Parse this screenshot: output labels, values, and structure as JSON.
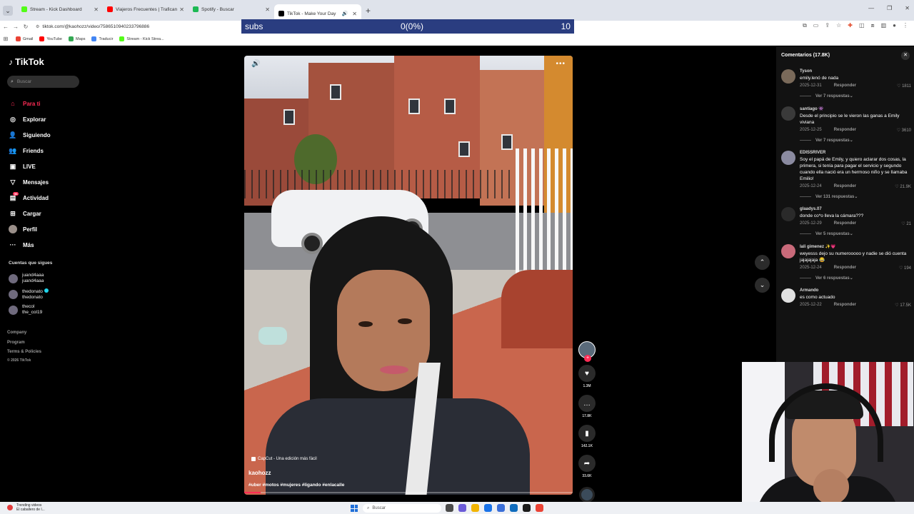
{
  "browser": {
    "tabs": [
      {
        "title": "Stream - Kick Dashboard",
        "favicon_color": "#53fc18"
      },
      {
        "title": "Viajeros Frecuentes | Traficante...",
        "favicon_color": "#ff0000"
      },
      {
        "title": "Spotify - Buscar",
        "favicon_color": "#1db954"
      },
      {
        "title": "TikTok - Make Your Day",
        "favicon_color": "#000000",
        "active": true
      }
    ],
    "url": "tiktok.com/@kaohozz/video/7586510940233796886",
    "bookmarks": [
      {
        "label": "Gmail",
        "color": "#ea4335"
      },
      {
        "label": "YouTube",
        "color": "#ff0000"
      },
      {
        "label": "Maps",
        "color": "#34a853"
      },
      {
        "label": "Traducir",
        "color": "#4285f4"
      },
      {
        "label": "Stream - Kick Strea...",
        "color": "#53fc18"
      }
    ]
  },
  "subs_overlay": {
    "label": "subs",
    "progress": "0(0%)",
    "goal": "10"
  },
  "sidebar": {
    "logo": "TikTok",
    "search_placeholder": "Buscar",
    "nav": [
      {
        "label": "Para ti",
        "icon": "home-icon",
        "glyph": "⌂",
        "active": true
      },
      {
        "label": "Explorar",
        "icon": "compass-icon",
        "glyph": "◎"
      },
      {
        "label": "Siguiendo",
        "icon": "user-follow-icon",
        "glyph": "👤"
      },
      {
        "label": "Friends",
        "icon": "friends-icon",
        "glyph": "👥"
      },
      {
        "label": "LIVE",
        "icon": "live-icon",
        "glyph": "▣"
      },
      {
        "label": "Mensajes",
        "icon": "messages-icon",
        "glyph": "▽"
      },
      {
        "label": "Actividad",
        "icon": "activity-icon",
        "glyph": "▤",
        "badge": "56"
      },
      {
        "label": "Cargar",
        "icon": "upload-icon",
        "glyph": "⊞"
      },
      {
        "label": "Perfil",
        "icon": "profile-avatar-icon",
        "glyph": "",
        "avatar": true
      },
      {
        "label": "Más",
        "icon": "more-icon",
        "glyph": "···"
      }
    ],
    "following_title": "Cuentas que sigues",
    "following": [
      {
        "line1": "juand4aaa",
        "line2": "juand4aaa",
        "verified": false
      },
      {
        "line1": "thedonato",
        "line2": "thedonato",
        "verified": true
      },
      {
        "line1": "thecol",
        "line2": "the_col19",
        "verified": false
      }
    ],
    "links": [
      "Company",
      "Program",
      "Terms & Policies"
    ],
    "copyright": "© 2026 TikTok"
  },
  "video": {
    "watermark": "CapCut - Una edición más fácil",
    "author": "kaohozz",
    "hashtags": "#uber #motos #mujeres #ligando #enlacalle",
    "progress": 0.05
  },
  "actions": [
    {
      "name": "like",
      "glyph": "♥",
      "count": "1.3M"
    },
    {
      "name": "comment",
      "glyph": "…",
      "count": "17.8K"
    },
    {
      "name": "bookmark",
      "glyph": "▮",
      "count": "142.1K"
    },
    {
      "name": "share",
      "glyph": "➦",
      "count": "33.6K"
    }
  ],
  "comments": {
    "header": "Comentarios (17.8K)",
    "items": [
      {
        "user": "Tyson",
        "text": "emily.lenó de nada",
        "date": "2025-12-31",
        "reply": "Responder",
        "likes": "1811",
        "more": "Ver 7 respuestas"
      },
      {
        "user": "santiago 👾",
        "text": "Desde el principio se le vieron las ganas a Emily viviana",
        "date": "2025-12-25",
        "reply": "Responder",
        "likes": "3610",
        "more": "Ver 7 respuestas"
      },
      {
        "user": "EDISSRIVER",
        "text": "Soy el papá de Emily, y quiero aclarar dos cosas, la primera, si tenía para pagar el servicio y segundo cuando ella nació era un hermoso niño y se llamaba Emilio!",
        "date": "2025-12-24",
        "reply": "Responder",
        "likes": "21.9K",
        "more": "Ver 131 respuestas"
      },
      {
        "user": "glaadys.07",
        "text": "donde co*o lleva la cámara???",
        "date": "2025-12-29",
        "reply": "Responder",
        "likes": "21",
        "more": "Ver 5 respuestas"
      },
      {
        "user": "lali gimenez ✨💗",
        "text": "weyesss dejo su numerooooo y nadie se dió cuenta jajajajaja 😂",
        "date": "2025-12-24",
        "reply": "Responder",
        "likes": "194",
        "more": "Ver 6 respuestas"
      },
      {
        "user": "Armando",
        "text": "es como actuado",
        "date": "2025-12-22",
        "reply": "Responder",
        "likes": "17.5K",
        "more": ""
      }
    ]
  },
  "taskbar": {
    "news_line1": "Trending videos",
    "news_line2": "El caballero de l...",
    "search_placeholder": "Buscar",
    "apps": [
      "#4a4a4a",
      "#6b5bd8",
      "#f2b400",
      "#1a73e8",
      "#3b6fd8",
      "#0f6cbd",
      "#1a1a1a",
      "#ea4335"
    ]
  }
}
